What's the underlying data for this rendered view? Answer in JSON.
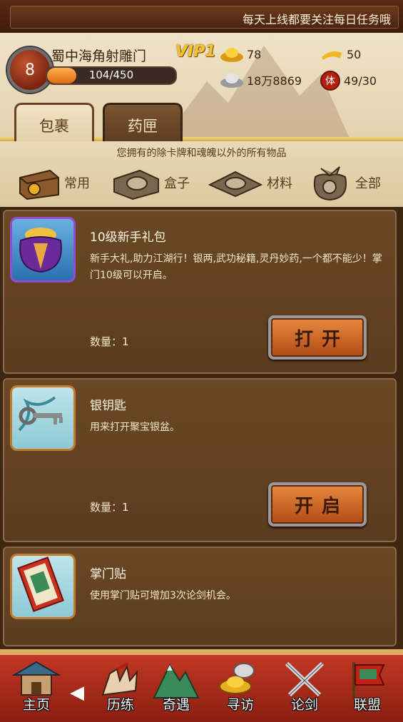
{
  "marquee": {
    "text": "每天上线都要关注每日任务哦"
  },
  "player": {
    "level": "8",
    "name": "蜀中海角射雕门",
    "vip": "VIP1",
    "exp_text": "104/450",
    "exp_fraction": 0.23
  },
  "resources": {
    "gold_ingot": "78",
    "gold_bar": "50",
    "silver": "18万8869",
    "stamina": "49/30"
  },
  "tabs": [
    {
      "label": "包裹",
      "active": true
    },
    {
      "label": "药匣",
      "active": false
    }
  ],
  "hint": "您拥有的除卡牌和魂魄以外的所有物品",
  "categories": [
    {
      "label": "常用",
      "icon": "chest-icon"
    },
    {
      "label": "盒子",
      "icon": "box-icon"
    },
    {
      "label": "材料",
      "icon": "materials-icon"
    },
    {
      "label": "全部",
      "icon": "bag-icon"
    }
  ],
  "items": [
    {
      "name": "10级新手礼包",
      "desc": "新手大礼,助力江湖行！银两,武功秘籍,灵丹妙药,一个都不能少！掌门10级可以开启。",
      "qty": "数量：1",
      "button": "打开",
      "icon": "gift-bag-icon"
    },
    {
      "name": "银钥匙",
      "desc": "用来打开聚宝银盆。",
      "qty": "数量：1",
      "button": "开启",
      "icon": "silver-key-icon"
    },
    {
      "name": "掌门贴",
      "desc": "使用掌门贴可增加3次论剑机会。",
      "icon": "sect-token-icon"
    }
  ],
  "nav": [
    {
      "label": "主页",
      "icon": "home-pagoda-icon"
    },
    {
      "label": "历练",
      "icon": "training-hand-icon"
    },
    {
      "label": "奇遇",
      "icon": "mountain-icon"
    },
    {
      "label": "寻访",
      "icon": "visit-icon"
    },
    {
      "label": "论剑",
      "icon": "crossed-swords-icon"
    },
    {
      "label": "联盟",
      "icon": "banner-icon"
    }
  ],
  "colors": {
    "accent": "#c23824",
    "parchment": "#e9d8b6",
    "card": "#5e3f20",
    "button": "#d06a28"
  }
}
